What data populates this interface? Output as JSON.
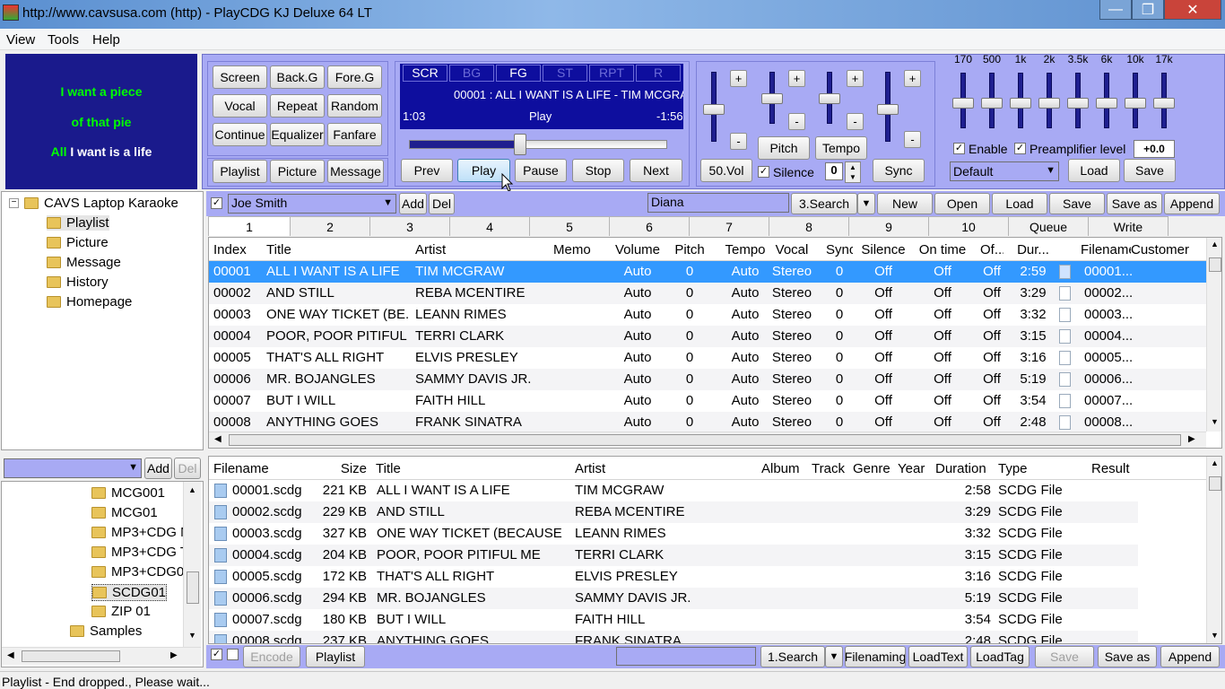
{
  "window": {
    "title": "http://www.cavsusa.com (http) - PlayCDG KJ Deluxe 64 LT",
    "min": "—",
    "max": "❐",
    "close": "✕"
  },
  "menu": [
    "View",
    "Tools",
    "Help"
  ],
  "lyrics": {
    "line1": "I want a piece",
    "line2": "of that pie",
    "line3_sung": "All",
    "line3_rest": " I want is a life"
  },
  "ctrl_buttons": [
    "Screen",
    "Back.G",
    "Fore.G",
    "Vocal",
    "Repeat",
    "Random",
    "Continue",
    "Equalizer",
    "Fanfare"
  ],
  "nav_buttons": [
    "Playlist",
    "Picture",
    "Message"
  ],
  "player": {
    "modes": [
      "SCR",
      "BG",
      "FG",
      "ST",
      "RPT",
      "R"
    ],
    "now": "00001 : ALL I WANT IS A LIFE - TIM MCGRAW",
    "elapsed": "1:03",
    "state": "Play",
    "remaining": "-1:56",
    "progress": 0.43
  },
  "transport": [
    "Prev",
    "Play",
    "Pause",
    "Stop",
    "Next"
  ],
  "mixer": {
    "pitch": "Pitch",
    "tempo": "Tempo",
    "vol": "50.Vol",
    "silence": "Silence",
    "silence_val": "0",
    "sync": "Sync",
    "plus": "+",
    "minus": "-"
  },
  "eq": {
    "bands": [
      "170",
      "500",
      "1k",
      "2k",
      "3.5k",
      "6k",
      "10k",
      "17k"
    ],
    "enable": "Enable",
    "preamp": "Preamplifier level",
    "preamp_val": "+0.0",
    "preset": "Default",
    "load": "Load",
    "save": "Save"
  },
  "tree": {
    "root": "CAVS Laptop Karaoke",
    "items": [
      "Playlist",
      "Picture",
      "Message",
      "History",
      "Homepage"
    ]
  },
  "singer": {
    "name": "Joe Smith",
    "add": "Add",
    "del": "Del",
    "search_val": "Diana",
    "search_btn": "3.Search",
    "buttons": [
      "New",
      "Open",
      "Load",
      "Save",
      "Save as",
      "Append"
    ]
  },
  "tabs": [
    "1",
    "2",
    "3",
    "4",
    "5",
    "6",
    "7",
    "8",
    "9",
    "10",
    "Queue",
    "Write"
  ],
  "playlist": {
    "headers": [
      "Index",
      "Title",
      "Artist",
      "Memo",
      "Volume",
      "Pitch",
      "Tempo",
      "Vocal",
      "Sync",
      "Silence",
      "On time",
      "Of...",
      "Dur...",
      "Filename",
      "Customer"
    ],
    "rows": [
      [
        "00001",
        "ALL I WANT IS A LIFE",
        "TIM MCGRAW",
        "",
        "Auto",
        "0",
        "Auto",
        "Stereo",
        "0",
        "Off",
        "Off",
        "Off",
        "2:59",
        "00001..."
      ],
      [
        "00002",
        "AND STILL",
        "REBA MCENTIRE",
        "",
        "Auto",
        "0",
        "Auto",
        "Stereo",
        "0",
        "Off",
        "Off",
        "Off",
        "3:29",
        "00002..."
      ],
      [
        "00003",
        "ONE WAY TICKET (BE...",
        "LEANN RIMES",
        "",
        "Auto",
        "0",
        "Auto",
        "Stereo",
        "0",
        "Off",
        "Off",
        "Off",
        "3:32",
        "00003..."
      ],
      [
        "00004",
        "POOR, POOR PITIFUL ...",
        "TERRI CLARK",
        "",
        "Auto",
        "0",
        "Auto",
        "Stereo",
        "0",
        "Off",
        "Off",
        "Off",
        "3:15",
        "00004..."
      ],
      [
        "00005",
        "THAT'S ALL RIGHT",
        "ELVIS PRESLEY",
        "",
        "Auto",
        "0",
        "Auto",
        "Stereo",
        "0",
        "Off",
        "Off",
        "Off",
        "3:16",
        "00005..."
      ],
      [
        "00006",
        "MR. BOJANGLES",
        "SAMMY DAVIS JR.",
        "",
        "Auto",
        "0",
        "Auto",
        "Stereo",
        "0",
        "Off",
        "Off",
        "Off",
        "5:19",
        "00006..."
      ],
      [
        "00007",
        "BUT I WILL",
        "FAITH HILL",
        "",
        "Auto",
        "0",
        "Auto",
        "Stereo",
        "0",
        "Off",
        "Off",
        "Off",
        "3:54",
        "00007..."
      ],
      [
        "00008",
        "ANYTHING GOES",
        "FRANK SINATRA",
        "",
        "Auto",
        "0",
        "Auto",
        "Stereo",
        "0",
        "Off",
        "Off",
        "Off",
        "2:48",
        "00008..."
      ]
    ]
  },
  "folder_panel": {
    "add": "Add",
    "del": "Del",
    "items": [
      "MCG001",
      "MCG01",
      "MP3+CDG N",
      "MP3+CDG T",
      "MP3+CDG0",
      "SCDG01",
      "ZIP 01",
      "Samples"
    ]
  },
  "files": {
    "headers": [
      "Filename",
      "Size",
      "Title",
      "Artist",
      "Album",
      "Track",
      "Genre",
      "Year",
      "Duration",
      "Type",
      "Result"
    ],
    "rows": [
      [
        "00001.scdg",
        "221 KB",
        "ALL I WANT IS A LIFE",
        "TIM MCGRAW",
        "2:58",
        "SCDG File"
      ],
      [
        "00002.scdg",
        "229 KB",
        "AND STILL",
        "REBA MCENTIRE",
        "3:29",
        "SCDG File"
      ],
      [
        "00003.scdg",
        "327 KB",
        "ONE WAY TICKET (BECAUSE",
        "LEANN RIMES",
        "3:32",
        "SCDG File"
      ],
      [
        "00004.scdg",
        "204 KB",
        "POOR, POOR PITIFUL ME",
        "TERRI CLARK",
        "3:15",
        "SCDG File"
      ],
      [
        "00005.scdg",
        "172 KB",
        "THAT'S ALL RIGHT",
        "ELVIS PRESLEY",
        "3:16",
        "SCDG File"
      ],
      [
        "00006.scdg",
        "294 KB",
        "MR. BOJANGLES",
        "SAMMY DAVIS JR.",
        "5:19",
        "SCDG File"
      ],
      [
        "00007.scdg",
        "180 KB",
        "BUT I WILL",
        "FAITH HILL",
        "3:54",
        "SCDG File"
      ],
      [
        "00008.scdg",
        "237 KB",
        "ANYTHING GOES",
        "FRANK SINATRA",
        "2:48",
        "SCDG File"
      ]
    ]
  },
  "bottom": {
    "encode": "Encode",
    "playlist": "Playlist",
    "search": "1.Search",
    "buttons": [
      "Filenaming",
      "LoadText",
      "LoadTag",
      "Save",
      "Save as",
      "Append"
    ]
  },
  "status": "Playlist - End dropped., Please wait...",
  "colors": {
    "accent": "#a8aaf4",
    "select": "#3399ff",
    "lyrics_bg": "#1a1a8c",
    "lyrics_fg": "#00ff00"
  }
}
